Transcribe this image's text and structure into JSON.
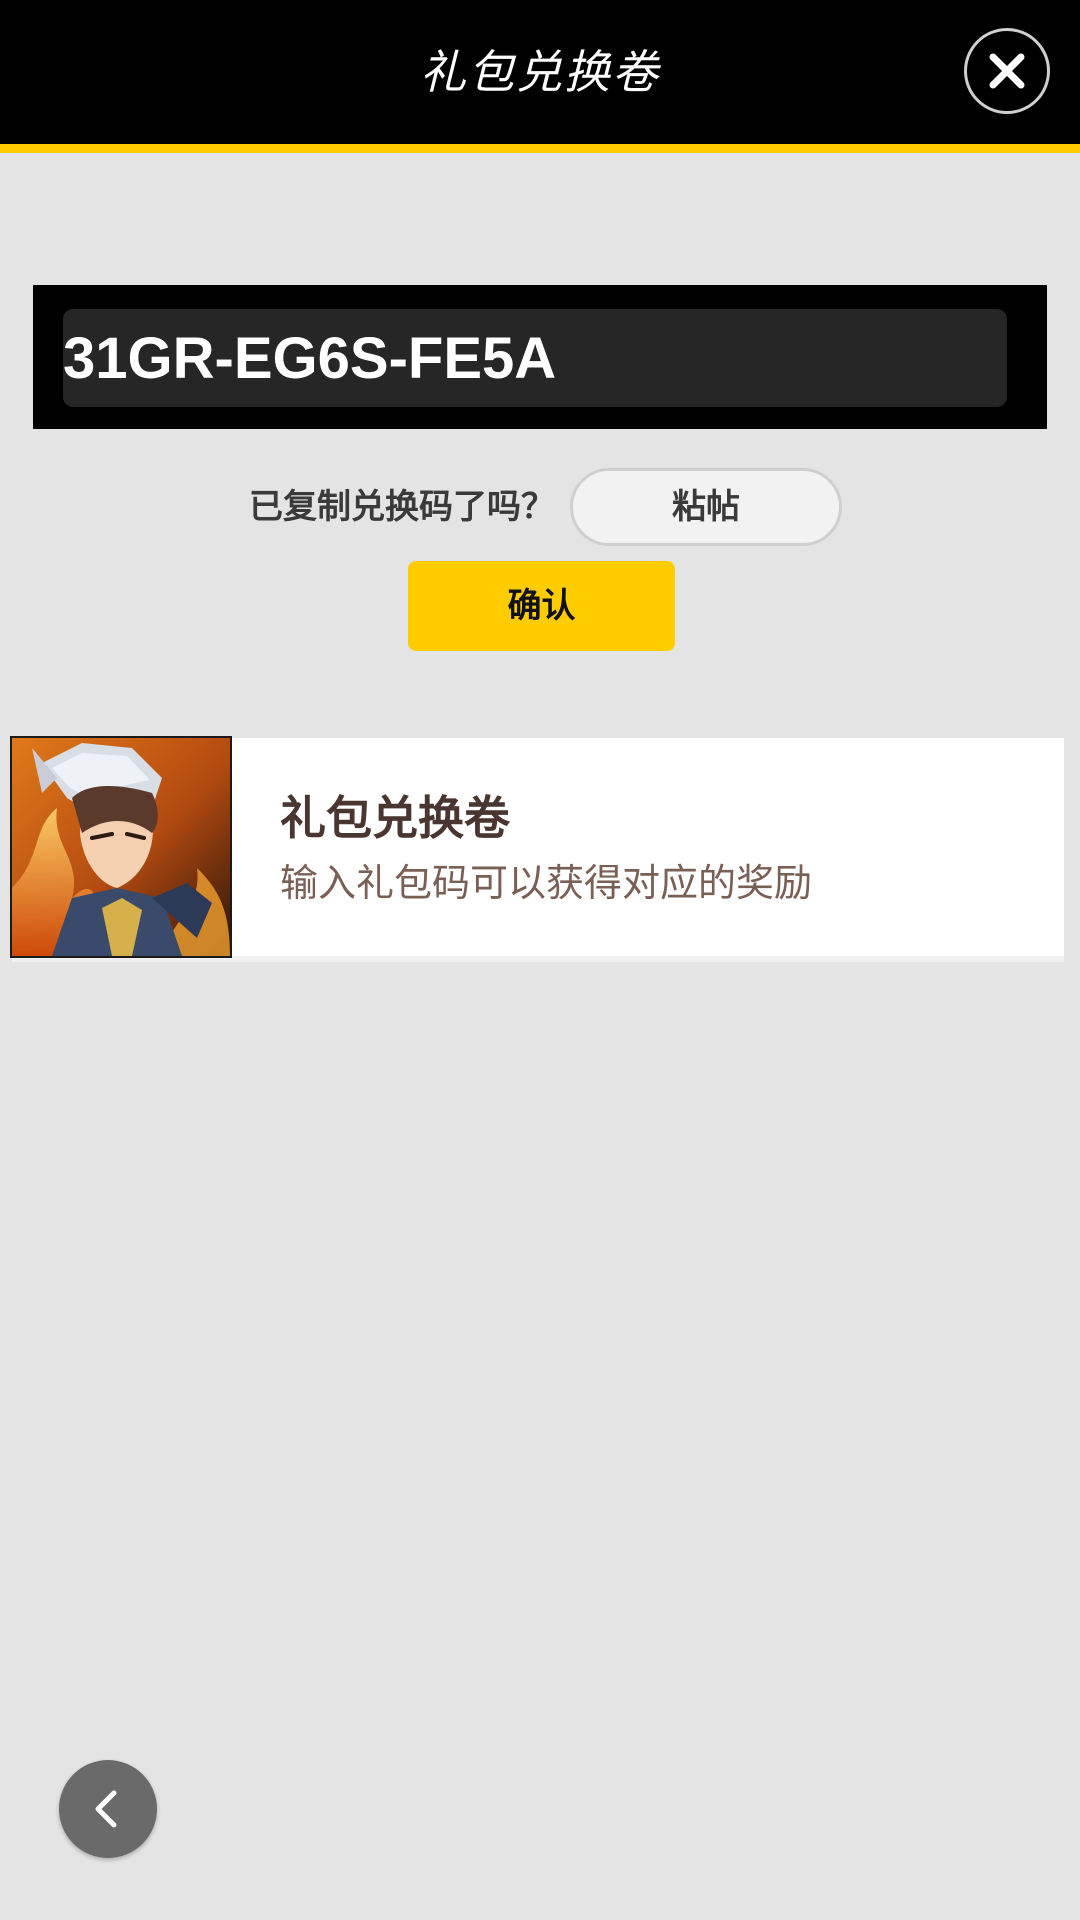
{
  "header": {
    "title": "礼包兑换卷",
    "close_icon": "close-icon"
  },
  "code_input": {
    "value": "31GR-EG6S-FE5A"
  },
  "paste": {
    "question": "已复制兑换码了吗？",
    "button_label": "粘帖"
  },
  "confirm": {
    "label": "确认"
  },
  "card": {
    "title": "礼包兑换卷",
    "description": "输入礼包码可以获得对应的奖励",
    "image": "hero-portrait-image"
  },
  "nav": {
    "back_icon": "chevron-left-icon"
  },
  "colors": {
    "accent": "#ffcc00",
    "header_bg": "#000000",
    "page_bg": "#e4e4e4"
  }
}
